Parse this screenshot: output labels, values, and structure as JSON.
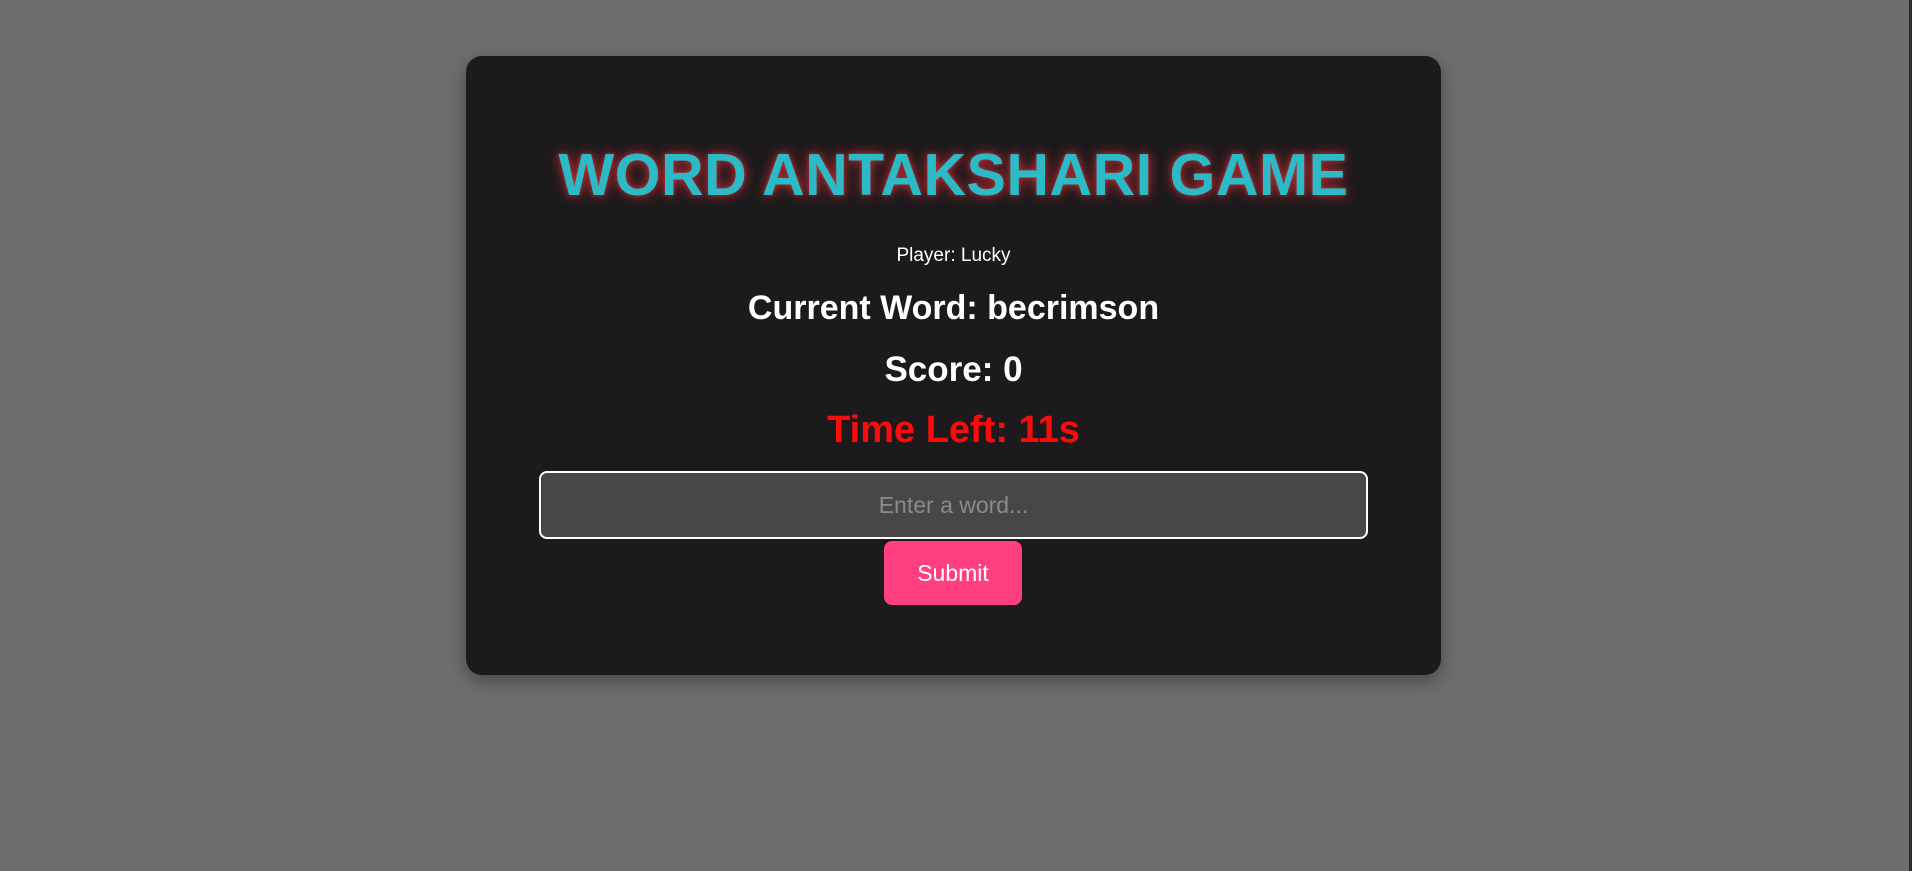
{
  "game": {
    "title": "WORD ANTAKSHARI GAME",
    "player_line": "Player: Lucky",
    "current_word_line": "Current Word: becrimson",
    "score_line": "Score: 0",
    "time_left_line": "Time Left: 11s"
  },
  "input": {
    "value": "",
    "placeholder": "Enter a word..."
  },
  "actions": {
    "submit_label": "Submit"
  },
  "colors": {
    "background": "#6e6e6e",
    "card": "#1c1a1c",
    "title": "#2bbac6",
    "timer": "#ff0a0a",
    "submit_button": "#ff3f7f"
  }
}
